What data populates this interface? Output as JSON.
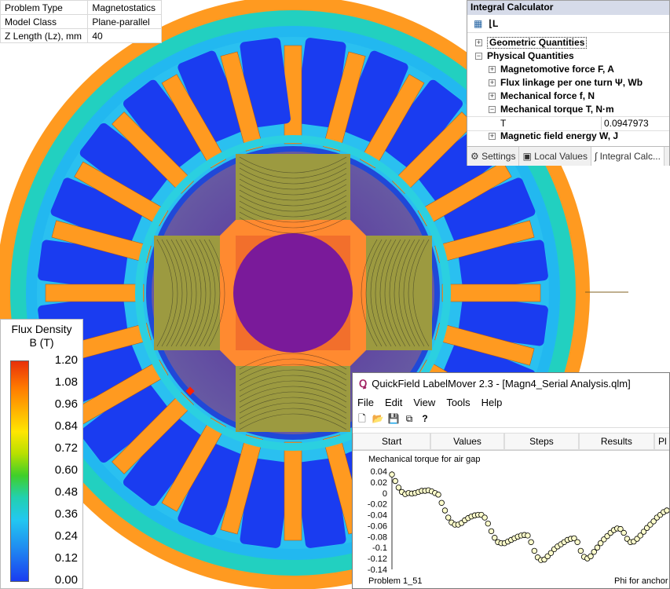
{
  "info": {
    "rows": [
      {
        "key": "Problem Type",
        "value": "Magnetostatics"
      },
      {
        "key": "Model Class",
        "value": "Plane-parallel"
      },
      {
        "key": "Z Length (Lz), mm",
        "value": "40"
      }
    ]
  },
  "legend": {
    "title": "Flux Density",
    "unit": "B (T)",
    "ticks": [
      "1.20",
      "1.08",
      "0.96",
      "0.84",
      "0.72",
      "0.60",
      "0.48",
      "0.36",
      "0.24",
      "0.12",
      "0.00"
    ]
  },
  "calc": {
    "title": "Integral Calculator",
    "items": {
      "geom": "Geometric Quantities",
      "phys": "Physical Quantities",
      "mmf": "Magnetomotive force F, A",
      "flux": "Flux linkage per one turn Ψ, Wb",
      "force": "Mechanical force f, N",
      "torque": "Mechanical torque T, N·m",
      "energy": "Magnetic field energy W, J"
    },
    "torque_row": {
      "name": "T",
      "value": "0.0947973"
    },
    "tabs": {
      "settings": "Settings",
      "local": "Local Values",
      "integral": "Integral Calc..."
    }
  },
  "labelmover": {
    "title": "QuickField LabelMover 2.3 - [Magn4_Serial Analysis.qlm]",
    "menu": [
      "File",
      "Edit",
      "View",
      "Tools",
      "Help"
    ],
    "steps": [
      "Start",
      "Values",
      "Steps",
      "Results",
      "Pl"
    ],
    "plot_title": "Mechanical torque for air gap",
    "problem_label": "Problem 1_51",
    "xlabel": "Phi for anchor"
  },
  "colors": {
    "field_blue": "#1a3cf0",
    "field_cyan": "#22c8f0",
    "field_orange": "#ff9a20",
    "field_red": "#e8300a",
    "rotor_purple": "#6a2a9a",
    "marker_yellow": "#ffffcc"
  },
  "chart_data": {
    "type": "scatter",
    "title": "Mechanical torque for air gap",
    "xlabel": "Phi for anchor",
    "ylabel": "",
    "ylim": [
      -0.14,
      0.04
    ],
    "yticks": [
      "0.04",
      "0.02",
      "0",
      "-0.02",
      "-0.04",
      "-0.06",
      "-0.08",
      "-0.1",
      "-0.12",
      "-0.14"
    ],
    "series": [
      {
        "values": [
          0.034,
          0.022,
          0.01,
          0.002,
          -0.002,
          0.0,
          -0.001,
          0.0,
          0.002,
          0.004,
          0.004,
          0.005,
          0.003,
          0.0,
          -0.003,
          -0.018,
          -0.032,
          -0.045,
          -0.054,
          -0.058,
          -0.058,
          -0.055,
          -0.05,
          -0.046,
          -0.043,
          -0.041,
          -0.04,
          -0.04,
          -0.045,
          -0.056,
          -0.07,
          -0.082,
          -0.09,
          -0.092,
          -0.092,
          -0.089,
          -0.086,
          -0.083,
          -0.08,
          -0.078,
          -0.077,
          -0.078,
          -0.09,
          -0.106,
          -0.118,
          -0.123,
          -0.122,
          -0.116,
          -0.11,
          -0.103,
          -0.098,
          -0.094,
          -0.09,
          -0.086,
          -0.084,
          -0.083,
          -0.09,
          -0.106,
          -0.117,
          -0.12,
          -0.116,
          -0.108,
          -0.1,
          -0.092,
          -0.085,
          -0.079,
          -0.073,
          -0.068,
          -0.065,
          -0.066,
          -0.073,
          -0.084,
          -0.09,
          -0.089,
          -0.084,
          -0.078,
          -0.071,
          -0.064,
          -0.058,
          -0.052,
          -0.045,
          -0.04,
          -0.035,
          -0.032
        ]
      }
    ]
  }
}
